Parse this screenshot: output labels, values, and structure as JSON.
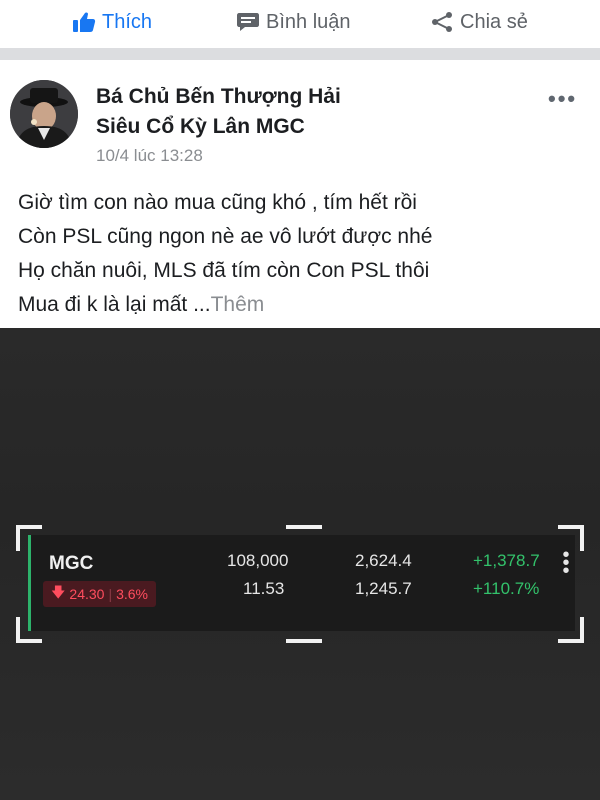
{
  "actions": {
    "like_label": "Thích",
    "comment_label": "Bình luận",
    "share_label": "Chia sẻ"
  },
  "post": {
    "author_line1": "Bá Chủ Bến Thượng Hải",
    "author_line2": "Siêu Cổ Kỳ Lân MGC",
    "timestamp": "10/4 lúc 13:28",
    "more_label": "•••",
    "text_lines": [
      "Giờ tìm con nào mua cũng khó , tím hết rồi",
      "Còn PSL cũng ngon nè ae vô lướt  được nhé",
      "Họ chăn nuôi, MLS đã tím còn Con PSL thôi",
      "Mua đi k là lại mất ..."
    ],
    "see_more": "Thêm"
  },
  "stock": {
    "ticker": "MGC",
    "change_value": "24.30",
    "change_percent": "3.6%",
    "volume": "108,000",
    "pe": "11.53",
    "value_top": "2,624.4",
    "value_bottom": "1,245.7",
    "gain_top": "+1,378.7",
    "gain_bottom": "+110.7%",
    "up_color": "#33c26b",
    "down_color": "#ff4d5e"
  }
}
